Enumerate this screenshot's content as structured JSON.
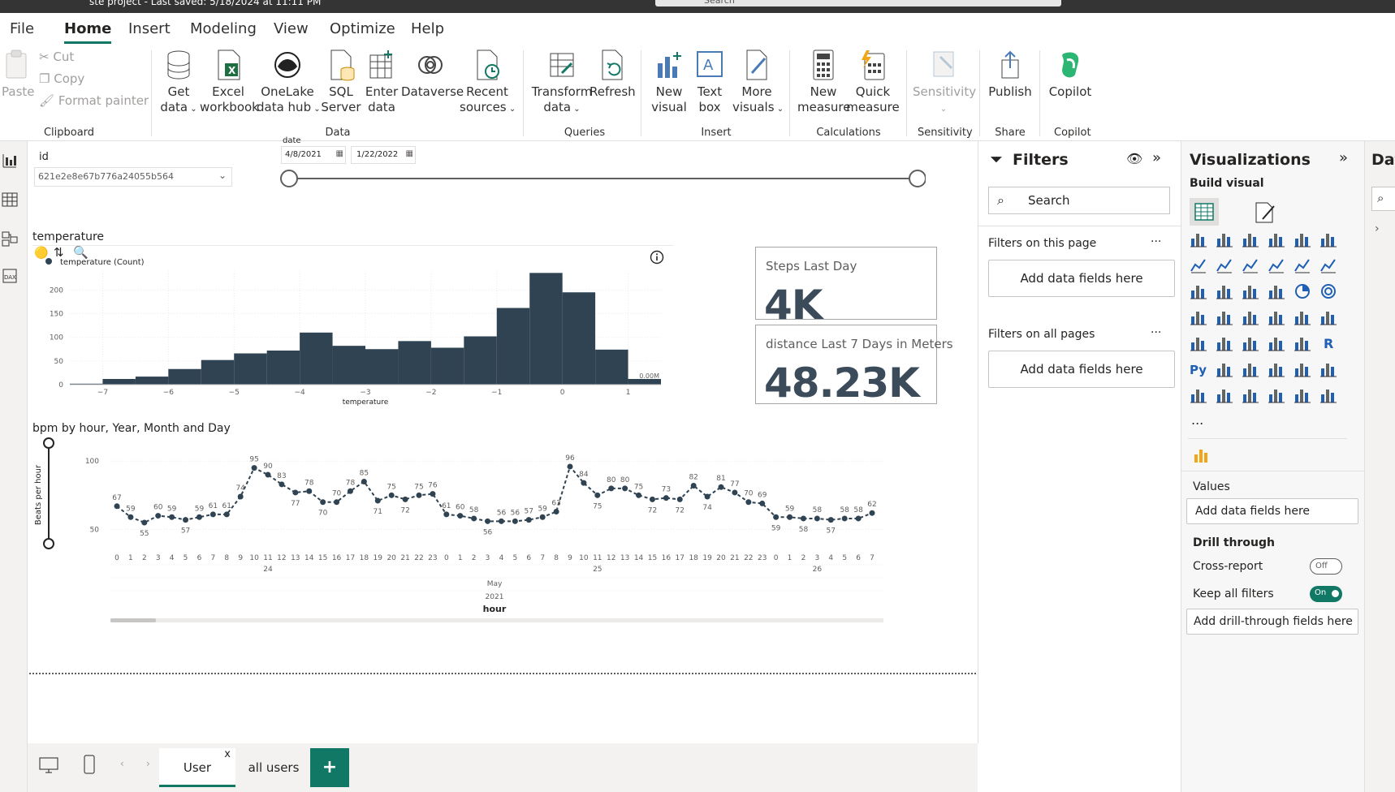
{
  "titlebar": {
    "title": "ste project - Last saved: 5/18/2024 at 11:11 PM",
    "search": "Search"
  },
  "menu": [
    "File",
    "Home",
    "Insert",
    "Modeling",
    "View",
    "Optimize",
    "Help"
  ],
  "ribbon": {
    "clipboard": {
      "paste": "Paste",
      "cut": "Cut",
      "copy": "Copy",
      "format_painter": "Format painter",
      "group": "Clipboard"
    },
    "data": {
      "get_data": [
        "Get",
        "data"
      ],
      "excel": [
        "Excel",
        "workbook"
      ],
      "onelake": [
        "OneLake",
        "data hub"
      ],
      "sql": [
        "SQL",
        "Server"
      ],
      "enter": [
        "Enter",
        "data"
      ],
      "dataverse": "Dataverse",
      "recent": [
        "Recent",
        "sources"
      ],
      "group": "Data"
    },
    "queries": {
      "transform": [
        "Transform",
        "data"
      ],
      "refresh": "Refresh",
      "group": "Queries"
    },
    "insert": {
      "new_visual": [
        "New",
        "visual"
      ],
      "text_box": [
        "Text",
        "box"
      ],
      "more_visuals": [
        "More",
        "visuals"
      ],
      "group": "Insert"
    },
    "calculations": {
      "new_measure": [
        "New",
        "measure"
      ],
      "quick_measure": [
        "Quick",
        "measure"
      ],
      "group": "Calculations"
    },
    "sensitivity": {
      "label": "Sensitivity",
      "group": "Sensitivity"
    },
    "share": {
      "label": "Publish",
      "group": "Share"
    },
    "copilot": {
      "label": "Copilot",
      "group": "Copilot"
    }
  },
  "slicers": {
    "id_label": "id",
    "id_value": "621e2e8e67b776a24055b564",
    "date_label": "date",
    "date_from": "4/8/2021",
    "date_to": "1/22/2022"
  },
  "cards": [
    {
      "title": "Steps Last Day",
      "value": "4K"
    },
    {
      "title": "distance Last 7 Days in Meters",
      "value": "48.23K"
    }
  ],
  "chart_data": [
    {
      "type": "bar",
      "title": "temperature",
      "legend": "temperature (Count)",
      "xlabel": "temperature",
      "ylabel": "",
      "x_ticks": [
        -7,
        -6,
        -5,
        -4,
        -3,
        -2,
        -1,
        0,
        1
      ],
      "y_ticks": [
        0,
        50,
        100,
        150,
        200
      ],
      "ylim": [
        0,
        240
      ],
      "bin_edges": [
        -7.5,
        -7,
        -6.5,
        -6,
        -5.5,
        -5,
        -4.5,
        -4,
        -3.5,
        -3,
        -2.5,
        -2,
        -1.5,
        -1,
        -0.5,
        0,
        0.5,
        1,
        1.5
      ],
      "values": [
        2,
        12,
        17,
        33,
        52,
        66,
        72,
        110,
        82,
        75,
        92,
        78,
        102,
        162,
        236,
        195,
        74,
        12
      ],
      "annotation": "0.00M"
    },
    {
      "type": "line",
      "title": "bpm by hour, Year, Month and Day",
      "ylabel": "Beats per hour",
      "xlabel": "hour",
      "y_ticks": [
        50,
        100
      ],
      "ylim": [
        36,
        112
      ],
      "x": [
        "0",
        "1",
        "2",
        "3",
        "4",
        "5",
        "6",
        "7",
        "8",
        "9",
        "10",
        "11",
        "12",
        "13",
        "14",
        "15",
        "16",
        "17",
        "18",
        "19",
        "20",
        "21",
        "22",
        "23",
        "0",
        "1",
        "2",
        "3",
        "4",
        "5",
        "6",
        "7",
        "8",
        "9",
        "10",
        "11",
        "12",
        "13",
        "14",
        "15",
        "16",
        "17",
        "18",
        "19",
        "20",
        "21",
        "22",
        "23",
        "0",
        "1",
        "2",
        "3",
        "4",
        "5",
        "6",
        "7"
      ],
      "day_labels": [
        {
          "label": "24",
          "at": 11
        },
        {
          "label": "25",
          "at": 35
        },
        {
          "label": "26",
          "at": 51
        }
      ],
      "month_label": "May",
      "year_label": "2021",
      "values": [
        67,
        59,
        55,
        60,
        59,
        57,
        59,
        61,
        61,
        74,
        95,
        90,
        83,
        77,
        78,
        70,
        70,
        78,
        85,
        71,
        75,
        72,
        75,
        76,
        61,
        60,
        58,
        56,
        56,
        56,
        57,
        59,
        63,
        96,
        84,
        75,
        80,
        80,
        75,
        72,
        73,
        72,
        82,
        74,
        81,
        77,
        70,
        69,
        59,
        59,
        58,
        58,
        57,
        58,
        58,
        62
      ]
    }
  ],
  "filters": {
    "title": "Filters",
    "search": "Search",
    "on_page": "Filters on this page",
    "on_all": "Filters on all pages",
    "add": "Add data fields here",
    "more": "..."
  },
  "viz": {
    "title": "Visualizations",
    "build": "Build visual",
    "more": "...",
    "values": "Values",
    "add_fields": "Add data fields here",
    "drill": "Drill through",
    "cross": "Cross-report",
    "cross_state": "Off",
    "keep": "Keep all filters",
    "keep_state": "On",
    "add_drill": "Add drill-through fields here",
    "r_icon": "R",
    "py_icon": "Py"
  },
  "data_pane": {
    "title": "Dat"
  },
  "pages": {
    "tab1": "User",
    "tab1_close": "x",
    "tab2": "all users",
    "add": "+"
  },
  "colors": {
    "accent": "#117865",
    "bar": "#2f4352",
    "card_value": "#3b4b5a"
  }
}
